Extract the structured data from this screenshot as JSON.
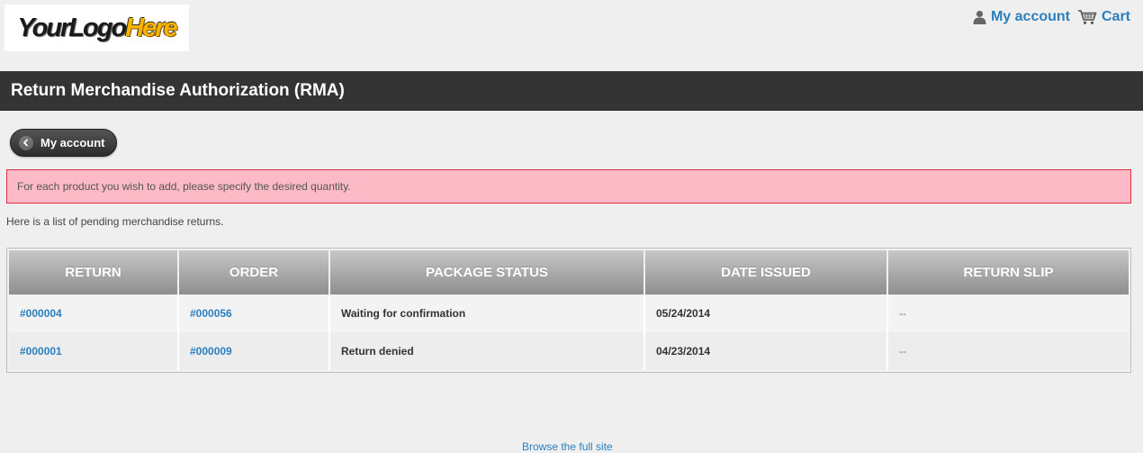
{
  "header": {
    "logo": {
      "part1": "YourLogo",
      "part2": "Here"
    },
    "account_link": "My account",
    "cart_link": "Cart"
  },
  "page_title": "Return Merchandise Authorization (RMA)",
  "back_button": "My account",
  "error_message": "For each product you wish to add, please specify the desired quantity.",
  "intro_text": "Here is a list of pending merchandise returns.",
  "table": {
    "headers": [
      "RETURN",
      "ORDER",
      "PACKAGE STATUS",
      "DATE ISSUED",
      "RETURN SLIP"
    ],
    "rows": [
      {
        "return": "#000004",
        "order": "#000056",
        "status": "Waiting for confirmation",
        "date": "05/24/2014",
        "slip": "--"
      },
      {
        "return": "#000001",
        "order": "#000009",
        "status": "Return denied",
        "date": "04/23/2014",
        "slip": "--"
      }
    ]
  },
  "footer_link": "Browse the full site",
  "colors": {
    "link": "#2b7fbf",
    "title_bar": "#343434",
    "error_bg": "#fbbac6",
    "error_border": "#e0303f"
  }
}
